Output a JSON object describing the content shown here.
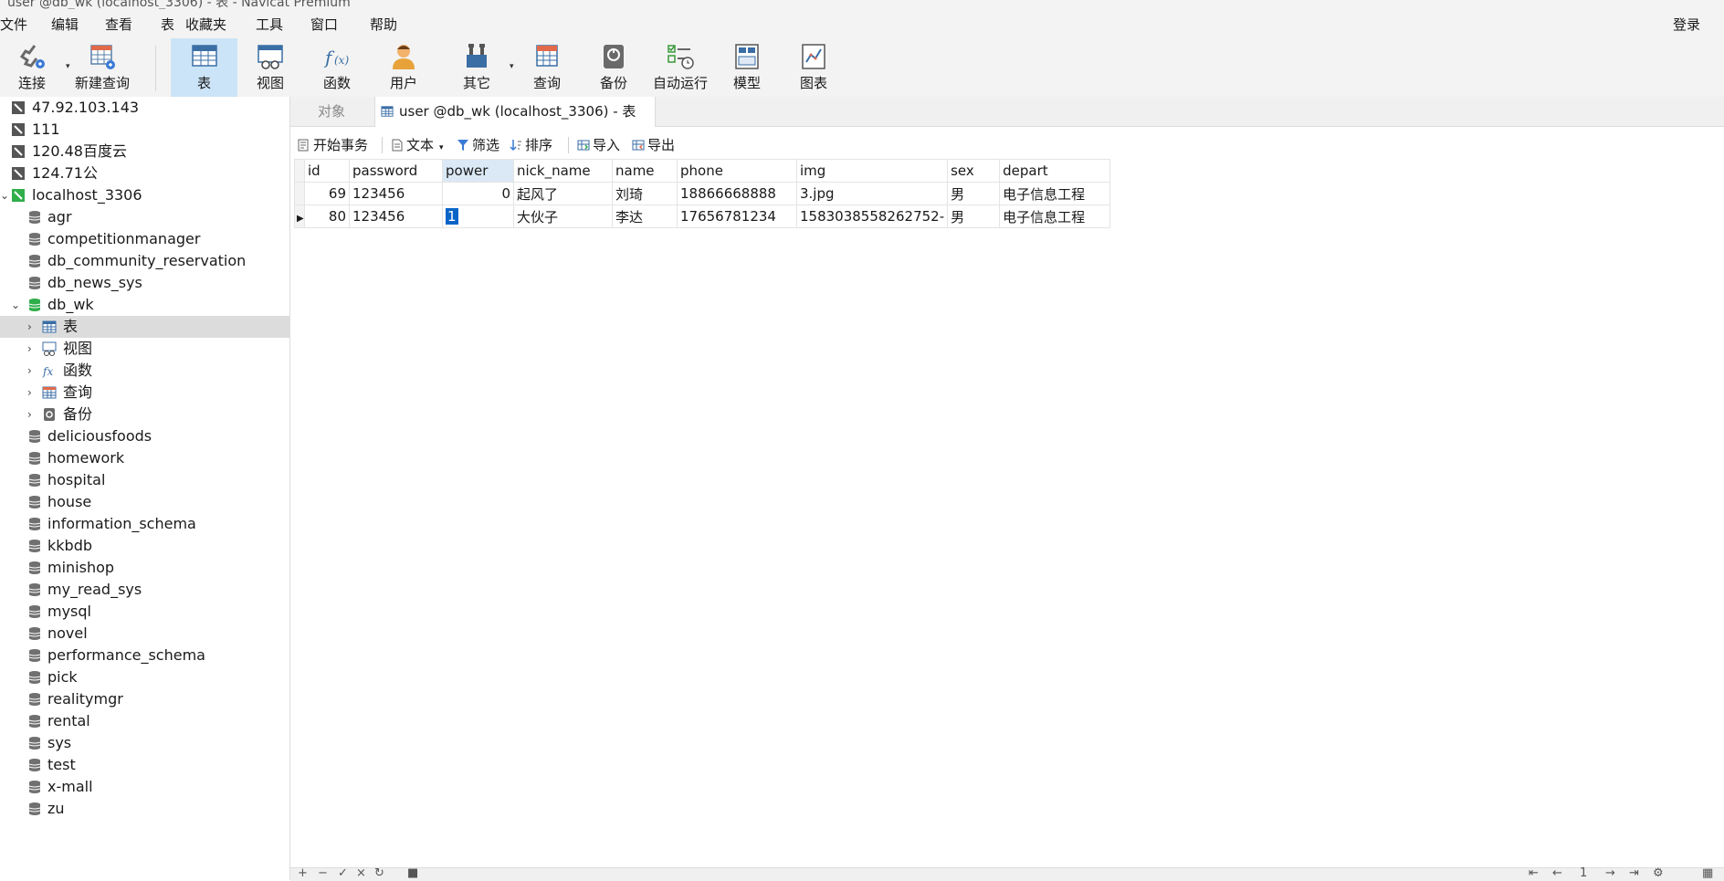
{
  "window": {
    "title": "user @db_wk (localhost_3306) - 表 - Navicat Premium"
  },
  "menu": [
    "文件",
    "编辑",
    "查看",
    "表",
    "收藏夹",
    "工具",
    "窗口",
    "帮助"
  ],
  "login_label": "登录",
  "toolbar": [
    {
      "label": "连接",
      "icon": "plug-icon"
    },
    {
      "label": "新建查询",
      "icon": "new-query-icon"
    },
    {
      "label": "表",
      "icon": "table-icon"
    },
    {
      "label": "视图",
      "icon": "view-icon"
    },
    {
      "label": "函数",
      "icon": "function-icon"
    },
    {
      "label": "用户",
      "icon": "user-icon"
    },
    {
      "label": "其它",
      "icon": "tools-icon"
    },
    {
      "label": "查询",
      "icon": "query-icon"
    },
    {
      "label": "备份",
      "icon": "backup-icon"
    },
    {
      "label": "自动运行",
      "icon": "schedule-icon"
    },
    {
      "label": "模型",
      "icon": "model-icon"
    },
    {
      "label": "图表",
      "icon": "chart-icon"
    }
  ],
  "sidebar": {
    "connections": [
      "47.92.103.143",
      "111",
      "120.48百度云",
      "124.71公"
    ],
    "active_connection": "localhost_3306",
    "databases_before": [
      "agr",
      "competitionmanager",
      "db_community_reservation",
      "db_news_sys"
    ],
    "open_database": "db_wk",
    "db_children": [
      "表",
      "视图",
      "函数",
      "查询",
      "备份"
    ],
    "databases_after": [
      "deliciousfoods",
      "homework",
      "hospital",
      "house",
      "information_schema",
      "kkbdb",
      "minishop",
      "my_read_sys",
      "mysql",
      "novel",
      "performance_schema",
      "pick",
      "realitymgr",
      "rental",
      "sys",
      "test",
      "x-mall",
      "zu"
    ]
  },
  "tabs": {
    "objects": "对象",
    "active": "user @db_wk (localhost_3306) - 表"
  },
  "subtoolbar": {
    "begin_tx": "开始事务",
    "text": "文本",
    "filter": "筛选",
    "sort": "排序",
    "import": "导入",
    "export": "导出"
  },
  "table": {
    "columns": [
      "id",
      "password",
      "power",
      "nick_name",
      "name",
      "phone",
      "img",
      "sex",
      "depart"
    ],
    "rows": [
      [
        "69",
        "123456",
        "0",
        "起风了",
        "刘琦",
        "18866668888",
        "3.jpg",
        "男",
        "电子信息工程"
      ],
      [
        "80",
        "123456",
        "1",
        "大伙子",
        "李达",
        "17656781234",
        "1583038558262752-",
        "男",
        "电子信息工程"
      ]
    ]
  },
  "footer": {
    "page": "1"
  },
  "colors": {
    "accent": "#cce4f7",
    "selected_row": "#dcdcdc",
    "cursor": "#0a64c8"
  }
}
